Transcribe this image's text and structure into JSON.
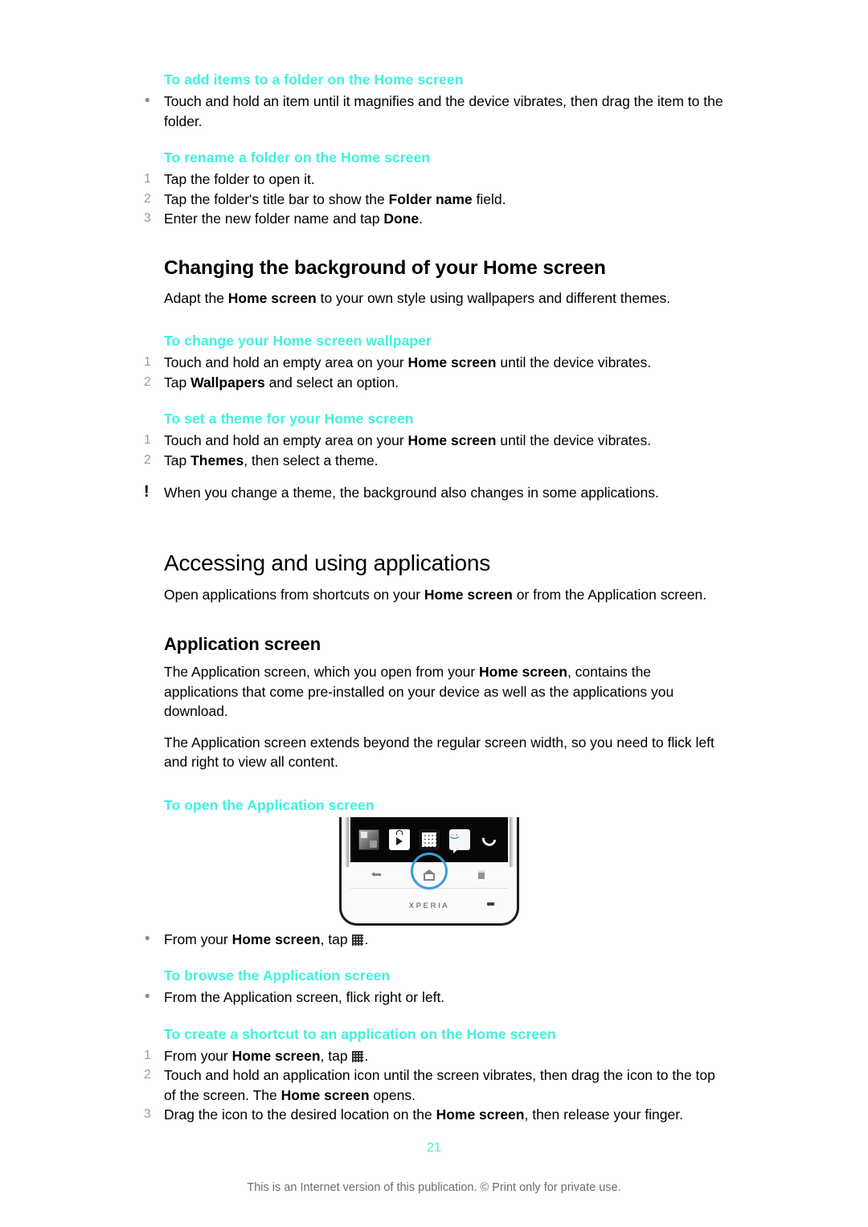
{
  "document": {
    "page_number": "21",
    "footer_note": "This is an Internet version of this publication. © Print only for private use.",
    "accent_color": "#3ff2dd"
  },
  "sections": {
    "add_items": {
      "heading": "To add items to a folder on the Home screen",
      "bullet1_a": "Touch and hold an item until it magnifies and the device vibrates, then drag the ",
      "bullet1_b": "item to the folder."
    },
    "rename_folder": {
      "heading": "To rename a folder on the Home screen",
      "step1_marker": "1",
      "step1": "Tap the folder to open it.",
      "step2_marker": "2",
      "step2_a": "Tap the folder's title bar to show the ",
      "step2_bold": "Folder name",
      "step2_b": " field.",
      "step3_marker": "3",
      "step3_a": "Enter the new folder name and tap ",
      "step3_bold": "Done",
      "step3_b": "."
    },
    "changing_background": {
      "heading": "Changing the background of your Home screen",
      "intro_a": "Adapt the ",
      "intro_bold": "Home screen",
      "intro_b": " to your own style using wallpapers and different themes."
    },
    "change_wallpaper": {
      "heading": "To change your Home screen wallpaper",
      "step1_marker": "1",
      "step1_a": "Touch and hold an empty area on your ",
      "step1_bold": "Home screen",
      "step1_b": " until the device vibrates.",
      "step2_marker": "2",
      "step2_a": "Tap ",
      "step2_bold": "Wallpapers",
      "step2_b": " and select an option."
    },
    "set_theme": {
      "heading": "To set a theme for your Home screen",
      "step1_marker": "1",
      "step1_a": "Touch and hold an empty area on your ",
      "step1_bold": "Home screen",
      "step1_b": " until the device vibrates.",
      "step2_marker": "2",
      "step2_a": "Tap ",
      "step2_bold": "Themes",
      "step2_b": ", then select a theme.",
      "note_marker": "!",
      "note": "When you change a theme, the background also changes in some applications."
    },
    "accessing": {
      "heading": "Accessing and using applications",
      "intro_a": "Open applications from shortcuts on your ",
      "intro_bold": "Home screen",
      "intro_b": " or from the Application screen."
    },
    "application_screen": {
      "heading": "Application screen",
      "p1_a": "The Application screen, which you open from your ",
      "p1_bold": "Home screen",
      "p1_b": ", contains the applications that come pre-installed on your device as well as the applications you download.",
      "p2": "The Application screen extends beyond the regular screen width, so you need to flick left and right to view all content."
    },
    "open_app_screen": {
      "heading": "To open the Application screen",
      "bullet_a": "From your ",
      "bullet_bold": "Home screen",
      "bullet_b": ", tap ",
      "bullet_c": "."
    },
    "browse_app_screen": {
      "heading": "To browse the Application screen",
      "bullet": "From the Application screen, flick right or left."
    },
    "create_shortcut": {
      "heading": "To create a shortcut to an application on the Home screen",
      "step1_marker": "1",
      "step1_a": "From your ",
      "step1_bold": "Home screen",
      "step1_b": ", tap ",
      "step1_c": ".",
      "step2_marker": "2",
      "step2_a": "Touch and hold an application icon until the screen vibrates, then drag the icon to the top of the screen. The ",
      "step2_bold": "Home screen",
      "step2_b": " opens.",
      "step3_marker": "3",
      "step3_a": "Drag the icon to the desired location on the ",
      "step3_bold": "Home screen",
      "step3_b": ", then release your finger."
    }
  },
  "figure": {
    "device_brand": "XPERIA",
    "dock_icons": [
      "gallery-widget-icon",
      "play-store-icon",
      "app-drawer-icon",
      "messaging-icon",
      "phone-call-icon"
    ],
    "nav_icons": [
      "back-icon",
      "home-icon",
      "recent-apps-icon"
    ],
    "highlight_target": "app-drawer-icon",
    "highlight_color": "#3b9fd8"
  }
}
